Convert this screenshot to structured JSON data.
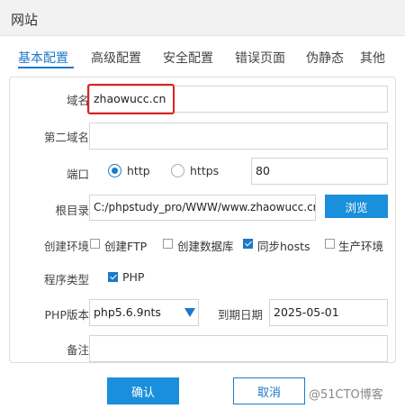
{
  "window": {
    "title": "网站"
  },
  "tabs": [
    {
      "label": "基本配置"
    },
    {
      "label": "高级配置"
    },
    {
      "label": "安全配置"
    },
    {
      "label": "错误页面"
    },
    {
      "label": "伪静态"
    },
    {
      "label": "其他"
    }
  ],
  "form": {
    "domain": {
      "label": "域名",
      "value": "zhaowucc.cn"
    },
    "second_domain": {
      "label": "第二域名",
      "value": ""
    },
    "port": {
      "label": "端口",
      "http_label": "http",
      "https_label": "https",
      "selected": "http",
      "value": "80"
    },
    "root": {
      "label": "根目录",
      "value": "C:/phpstudy_pro/WWW/www.zhaowucc.cn",
      "browse_label": "浏览"
    },
    "env": {
      "label": "创建环境",
      "options": [
        {
          "label": "创建FTP",
          "checked": false
        },
        {
          "label": "创建数据库",
          "checked": false
        },
        {
          "label": "同步hosts",
          "checked": true
        },
        {
          "label": "生产环境",
          "checked": false
        }
      ]
    },
    "program": {
      "label": "程序类型",
      "option": "PHP",
      "checked": true
    },
    "php_version": {
      "label": "PHP版本",
      "value": "php5.6.9nts"
    },
    "expire": {
      "label": "到期日期",
      "value": "2025-05-01"
    },
    "note": {
      "label": "备注",
      "value": ""
    }
  },
  "actions": {
    "confirm_label": "确认",
    "cancel_label": "取消"
  },
  "watermark": "@51CTO博客",
  "colors": {
    "accent": "#1c79c9",
    "primary_button": "#1a8fdb",
    "highlight": "#e02020"
  }
}
